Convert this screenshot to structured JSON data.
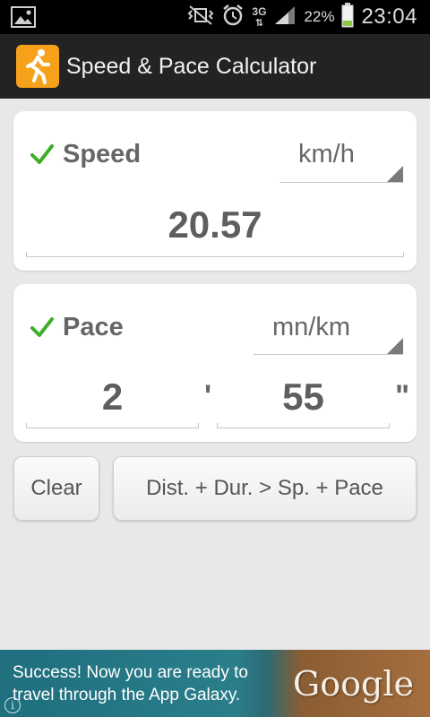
{
  "status_bar": {
    "image_icon": "image-icon",
    "mute_icon": "vibrate-mute-icon",
    "alarm_icon": "alarm-icon",
    "network_type": "3G",
    "signal_icon": "signal-bars-icon",
    "battery_percent": "22%",
    "battery_icon": "battery-icon",
    "time": "23:04"
  },
  "action_bar": {
    "app_icon": "runner-icon",
    "title": "Speed & Pace Calculator"
  },
  "speed_card": {
    "enabled": true,
    "label": "Speed",
    "unit": "km/h",
    "value": "20.57"
  },
  "pace_card": {
    "enabled": true,
    "label": "Pace",
    "unit": "mn/km",
    "minutes": "2",
    "minutes_mark": "'",
    "seconds": "55",
    "seconds_mark": "\""
  },
  "buttons": {
    "clear": "Clear",
    "calculate": "Dist. + Dur. > Sp. + Pace"
  },
  "ad": {
    "line1": "Success! Now you are ready to",
    "line2": "travel through the App Galaxy.",
    "brand": "Google",
    "info": "i"
  },
  "colors": {
    "accent_orange": "#f5a21a",
    "check_green": "#3fae29",
    "background": "#e8e8e8"
  }
}
